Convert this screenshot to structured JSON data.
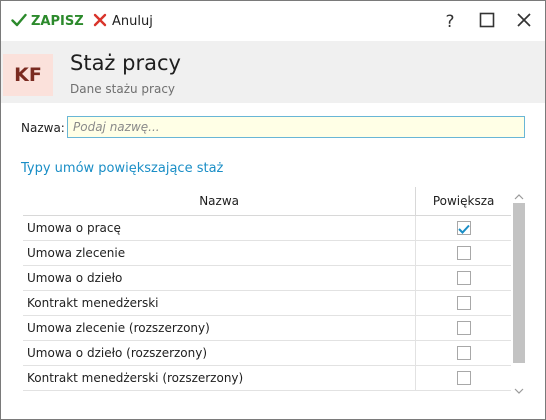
{
  "toolbar": {
    "save_label": "ZAPISZ",
    "cancel_label": "Anuluj",
    "help_symbol": "?"
  },
  "header": {
    "avatar": "KF",
    "title": "Staż pracy",
    "subtitle": "Dane stażu pracy"
  },
  "form": {
    "name_label": "Nazwa:",
    "name_placeholder": "Podaj nazwę...",
    "name_value": ""
  },
  "section": {
    "title": "Typy umów powiększające staż"
  },
  "table": {
    "columns": [
      "Nazwa",
      "Powiększa"
    ],
    "rows": [
      {
        "name": "Umowa o pracę",
        "checked": true
      },
      {
        "name": "Umowa zlecenie",
        "checked": false
      },
      {
        "name": "Umowa o dzieło",
        "checked": false
      },
      {
        "name": "Kontrakt menedżerski",
        "checked": false
      },
      {
        "name": "Umowa zlecenie (rozszerzony)",
        "checked": false
      },
      {
        "name": "Umowa o dzieło (rozszerzony)",
        "checked": false
      },
      {
        "name": "Kontrakt menedżerski (rozszerzony)",
        "checked": false
      }
    ]
  },
  "colors": {
    "accent": "#1a8ec6",
    "save_green": "#2c8a2c",
    "cancel_red": "#d9342b",
    "header_bg": "#f0f0f0",
    "avatar_bg": "#fbe1db",
    "input_bg": "#ffffe6"
  },
  "icons": {
    "save": "check-icon",
    "cancel": "x-icon",
    "help": "question-icon",
    "maximize": "maximize-icon",
    "close": "close-icon"
  }
}
